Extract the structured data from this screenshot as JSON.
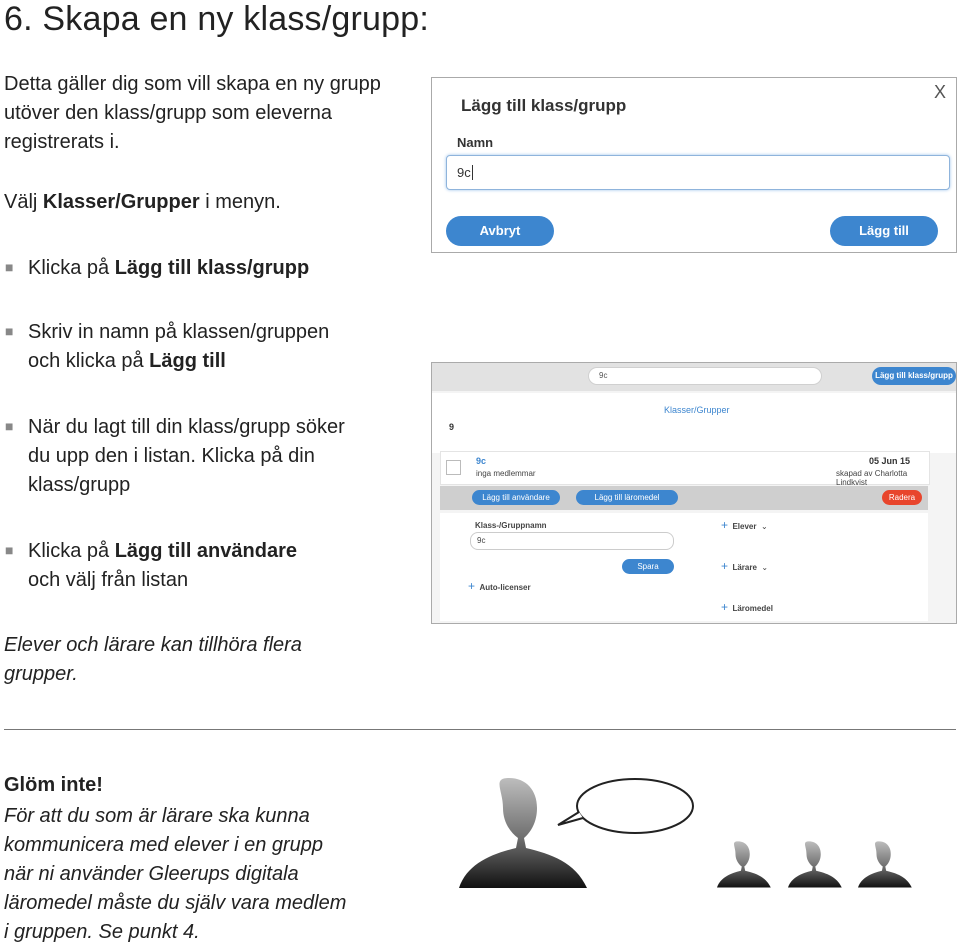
{
  "heading": "6. Skapa en ny klass/grupp:",
  "intro": {
    "line1": "Detta gäller dig som vill skapa en ny grupp",
    "line2": "utöver den klass/grupp som eleverna",
    "line3": "registrerats i.",
    "menu_pre": "Välj ",
    "menu_bold": "Klasser/Grupper",
    "menu_post": " i menyn."
  },
  "bullets": {
    "b1_pre": "Klicka på ",
    "b1_bold": "Lägg till klass/grupp",
    "b2_line1": "Skriv in namn på klassen/gruppen",
    "b2_pre": "och klicka på ",
    "b2_bold": "Lägg till",
    "b3_line1": "När du lagt till din klass/grupp söker",
    "b3_line2": "du upp den i listan. Klicka på din",
    "b3_line3": "klass/grupp",
    "b4_pre": "Klicka på ",
    "b4_bold": "Lägg till användare",
    "b4_line2": "och välj från listan"
  },
  "note": {
    "line1": "Elever och lärare kan tillhöra flera",
    "line2": "grupper."
  },
  "dialog": {
    "title": "Lägg till klass/grupp",
    "close": "X",
    "name_label": "Namn",
    "name_value": "9c",
    "cancel_label": "Avbryt",
    "add_label": "Lägg till"
  },
  "panel": {
    "search_value": "9c",
    "add_group_label": "Lägg till klass/grupp",
    "section_title": "Klasser/Grupper",
    "count": "9",
    "group_name": "9c",
    "group_members": "inga medlemmar",
    "group_date": "05 Jun 15",
    "group_creator": "skapad av Charlotta Lindkvist",
    "add_users_label": "Lägg till användare",
    "add_materials_label": "Lägg till läromedel",
    "delete_label": "Radera",
    "name_field_label": "Klass-/Gruppnamn",
    "name_field_value": "9c",
    "save_label": "Spara",
    "auto_licenses": "Auto-licenser",
    "students": "Elever",
    "teachers": "Lärare",
    "materials": "Läromedel"
  },
  "reminder": {
    "title": "Glöm inte!",
    "line1": "För att du som är lärare ska kunna",
    "line2": "kommunicera med elever i en grupp",
    "line3": "när ni använder Gleerups digitala",
    "line4": "läromedel måste du själv vara medlem",
    "line5": "i gruppen. Se punkt 4."
  },
  "icons": {
    "teacher": "person-silhouette-icon",
    "students": "person-silhouette-icon",
    "speech": "speech-bubble-icon"
  },
  "colors": {
    "accent": "#3d86cf",
    "delete": "#e8452c"
  }
}
